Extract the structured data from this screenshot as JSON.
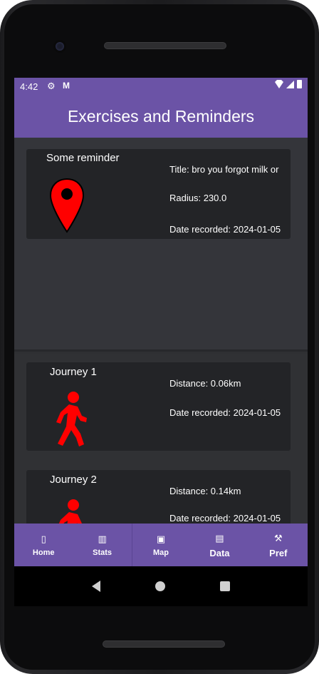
{
  "status_bar": {
    "time": "4:42",
    "gear_icon": "⚙",
    "mail_icon": "M"
  },
  "app_bar": {
    "title": "Exercises and Reminders"
  },
  "reminders": [
    {
      "name": "Some reminder",
      "icon": "location-pin-icon",
      "title_line": "Title: bro you forgot milk or",
      "radius_line": "Radius: 230.0",
      "date_line": "Date recorded: 2024-01-05"
    }
  ],
  "journeys": [
    {
      "name": "Journey 1",
      "icon": "walking-person-icon",
      "distance_line": "Distance: 0.06km",
      "date_line": "Date recorded: 2024-01-05"
    },
    {
      "name": "Journey 2",
      "icon": "walking-person-icon",
      "distance_line": "Distance: 0.14km",
      "date_line": "Date recorded: 2024-01-05"
    }
  ],
  "bottom_nav": [
    {
      "label": "Home",
      "icon": "home-icon",
      "glyph": "▯"
    },
    {
      "label": "Stats",
      "icon": "stats-icon",
      "glyph": "▥"
    },
    {
      "label": "Map",
      "icon": "map-icon",
      "glyph": "▣"
    },
    {
      "label": "Data",
      "icon": "data-icon",
      "glyph": "▤"
    },
    {
      "label": "Pref",
      "icon": "wrench-icon",
      "glyph": "⚒"
    }
  ],
  "colors": {
    "accent": "#6b53a6",
    "icon_red": "#ff0000",
    "card_bg": "#232427",
    "screen_bg": "#2f3033"
  }
}
